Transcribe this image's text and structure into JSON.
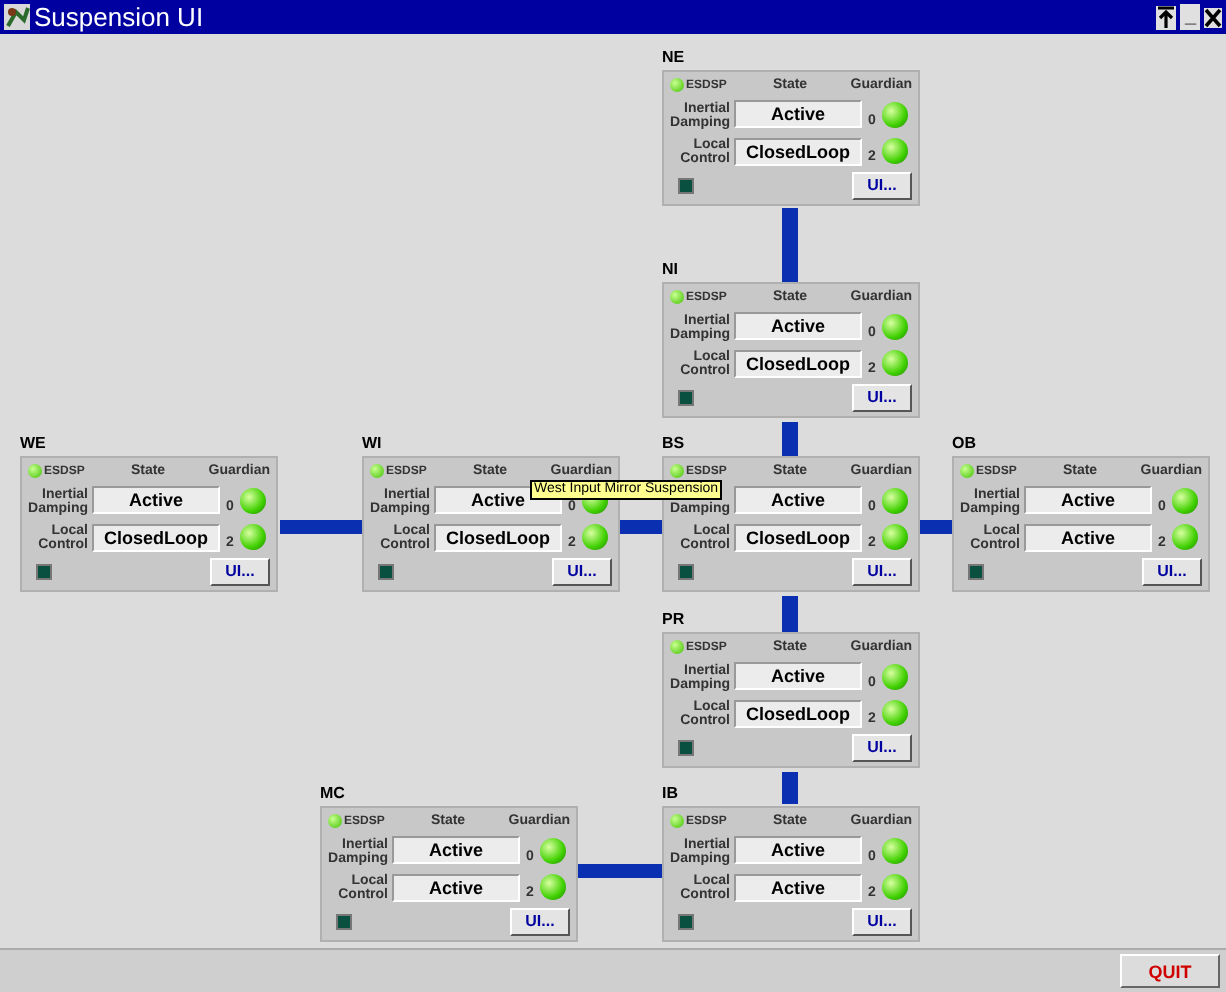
{
  "window": {
    "title": "Suspension UI",
    "buttons": [
      "_"
    ]
  },
  "nodes": [
    {
      "name": "NE",
      "esdsp": "ESDSP",
      "state_header": "State",
      "guardian_header": "Guardian",
      "rows": [
        {
          "label": "Inertial Damping",
          "state": "Active",
          "guardian": "0",
          "on": true
        },
        {
          "label": "Local Control",
          "state": "ClosedLoop",
          "guardian": "2",
          "on": true
        }
      ],
      "button": "UI..."
    },
    {
      "name": "NI",
      "esdsp": "ESDSP",
      "state_header": "State",
      "guardian_header": "Guardian",
      "rows": [
        {
          "label": "Inertial Damping",
          "state": "Active",
          "guardian": "0",
          "on": true
        },
        {
          "label": "Local Control",
          "state": "ClosedLoop",
          "guardian": "2",
          "on": true
        }
      ],
      "button": "UI..."
    },
    {
      "name": "WE",
      "esdsp": "ESDSP",
      "state_header": "State",
      "guardian_header": "Guardian",
      "rows": [
        {
          "label": "Inertial Damping",
          "state": "Active",
          "guardian": "0",
          "on": true
        },
        {
          "label": "Local Control",
          "state": "ClosedLoop",
          "guardian": "2",
          "on": true
        }
      ],
      "button": "UI..."
    },
    {
      "name": "WI",
      "esdsp": "ESDSP",
      "state_header": "State",
      "guardian_header": "Guardian",
      "rows": [
        {
          "label": "Inertial Damping",
          "state": "Active",
          "guardian": "0",
          "on": true
        },
        {
          "label": "Local Control",
          "state": "ClosedLoop",
          "guardian": "2",
          "on": true
        }
      ],
      "button": "UI..."
    },
    {
      "name": "BS",
      "esdsp": "ESDSP",
      "state_header": "State",
      "guardian_header": "Guardian",
      "rows": [
        {
          "label": "Damping",
          "state": "Active",
          "guardian": "0",
          "on": true
        },
        {
          "label": "Local Control",
          "state": "ClosedLoop",
          "guardian": "2",
          "on": true
        }
      ],
      "button": "UI..."
    },
    {
      "name": "OB",
      "esdsp": "ESDSP",
      "state_header": "State",
      "guardian_header": "Guardian",
      "rows": [
        {
          "label": "Inertial Damping",
          "state": "Active",
          "guardian": "0",
          "on": true
        },
        {
          "label": "Local Control",
          "state": "Active",
          "guardian": "2",
          "on": true
        }
      ],
      "button": "UI..."
    },
    {
      "name": "PR",
      "esdsp": "ESDSP",
      "state_header": "State",
      "guardian_header": "Guardian",
      "rows": [
        {
          "label": "Inertial Damping",
          "state": "Active",
          "guardian": "0",
          "on": true
        },
        {
          "label": "Local Control",
          "state": "ClosedLoop",
          "guardian": "2",
          "on": true
        }
      ],
      "button": "UI..."
    },
    {
      "name": "MC",
      "esdsp": "ESDSP",
      "state_header": "State",
      "guardian_header": "Guardian",
      "rows": [
        {
          "label": "Inertial Damping",
          "state": "Active",
          "guardian": "0",
          "on": true
        },
        {
          "label": "Local Control",
          "state": "Active",
          "guardian": "2",
          "on": true
        }
      ],
      "button": "UI..."
    },
    {
      "name": "IB",
      "esdsp": "ESDSP",
      "state_header": "State",
      "guardian_header": "Guardian",
      "rows": [
        {
          "label": "Inertial Damping",
          "state": "Active",
          "guardian": "0",
          "on": true
        },
        {
          "label": "Local Control",
          "state": "Active",
          "guardian": "2",
          "on": true
        }
      ],
      "button": "UI..."
    }
  ],
  "tooltip": "West Input Mirror Suspension",
  "quit_button": "QUIT"
}
